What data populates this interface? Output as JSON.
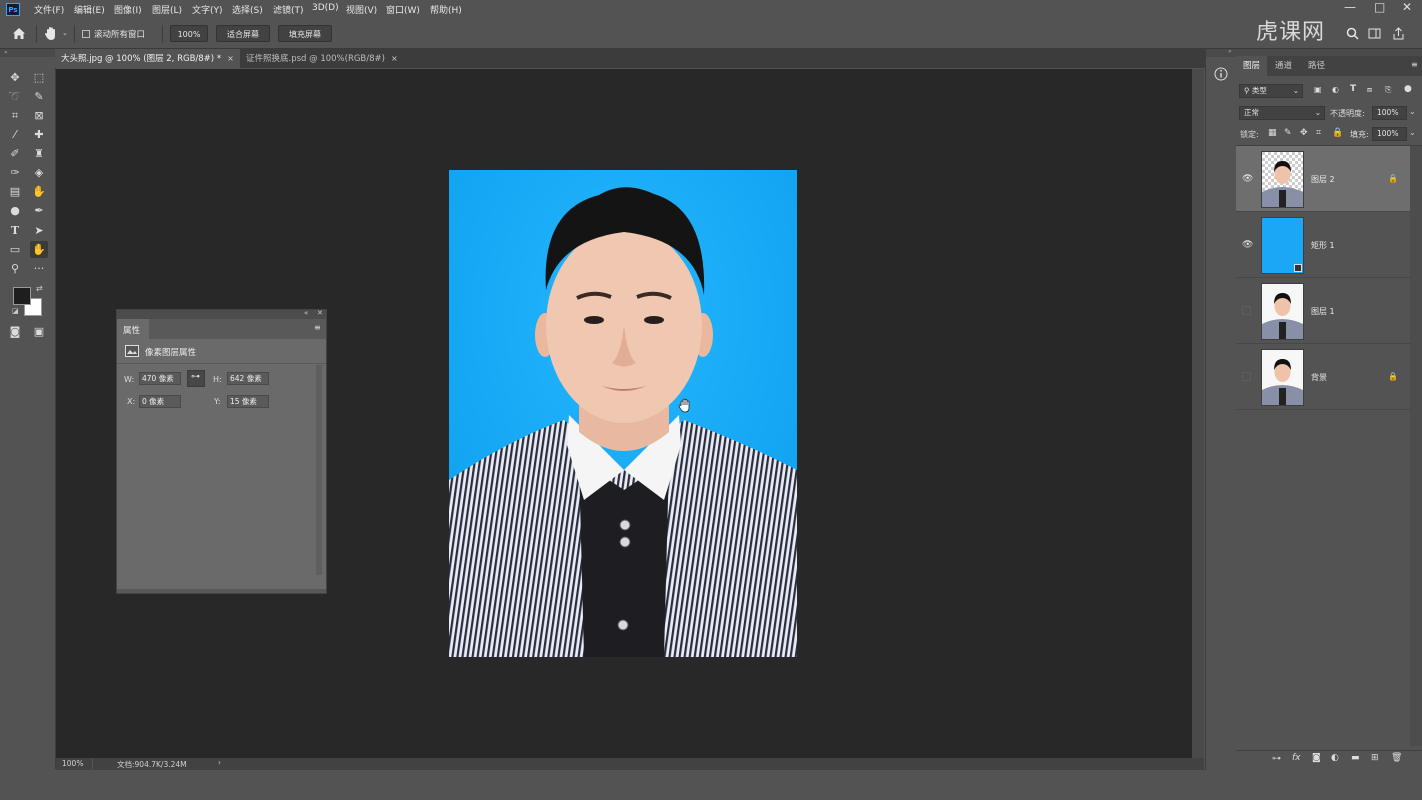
{
  "app": {
    "logo": "Ps"
  },
  "menu": [
    "文件(F)",
    "编辑(E)",
    "图像(I)",
    "图层(L)",
    "文字(Y)",
    "选择(S)",
    "滤镜(T)",
    "3D(D)",
    "视图(V)",
    "窗口(W)",
    "帮助(H)"
  ],
  "window_controls": [
    "—",
    "□",
    "✕"
  ],
  "watermark": "虎课网",
  "options": {
    "scroll_all_label": "滚动所有窗口",
    "zoom_value": "100%",
    "fit_screen": "适合屏幕",
    "fill_screen": "填充屏幕"
  },
  "tabs": [
    {
      "label": "大头照.jpg @ 100% (图层 2, RGB/8#) *",
      "active": true,
      "close": "×"
    },
    {
      "label": "证件照换底.psd @ 100%(RGB/8#)",
      "active": false,
      "close": "×"
    }
  ],
  "status": {
    "zoom": "100%",
    "doc": "文档:904.7K/3.24M",
    "arrow": "›"
  },
  "properties": {
    "tab": "属性",
    "section_title": "像素图层属性",
    "w_label": "W:",
    "w_value": "470 像素",
    "h_label": "H:",
    "h_value": "642 像素",
    "x_label": "X:",
    "x_value": "0 像素",
    "y_label": "Y:",
    "y_value": "15 像素"
  },
  "layers_panel": {
    "tabs": [
      "图层",
      "通道",
      "路径"
    ],
    "filter_kind": "类型",
    "blend_mode": "正常",
    "opacity_label": "不透明度:",
    "opacity_value": "100%",
    "lock_label": "锁定:",
    "fill_label": "填充:",
    "fill_value": "100%",
    "layers": [
      {
        "name": "图层 2",
        "visible": true,
        "selected": true,
        "locked": true,
        "thumb": "photo-transparent"
      },
      {
        "name": "矩形 1",
        "visible": true,
        "selected": false,
        "locked": false,
        "thumb": "blue-fill"
      },
      {
        "name": "图层 1",
        "visible": false,
        "selected": false,
        "locked": false,
        "thumb": "photo-white"
      },
      {
        "name": "背景",
        "visible": false,
        "selected": false,
        "locked": true,
        "thumb": "photo-white"
      }
    ],
    "footer_icons": [
      "link-icon",
      "fx-icon",
      "mask-icon",
      "adjustment-icon",
      "folder-icon",
      "new-layer-icon",
      "trash-icon"
    ]
  },
  "colors": {
    "photo_bg": "#1aa7f5",
    "canvas_bg": "#282828",
    "ui_bg": "#535353"
  }
}
